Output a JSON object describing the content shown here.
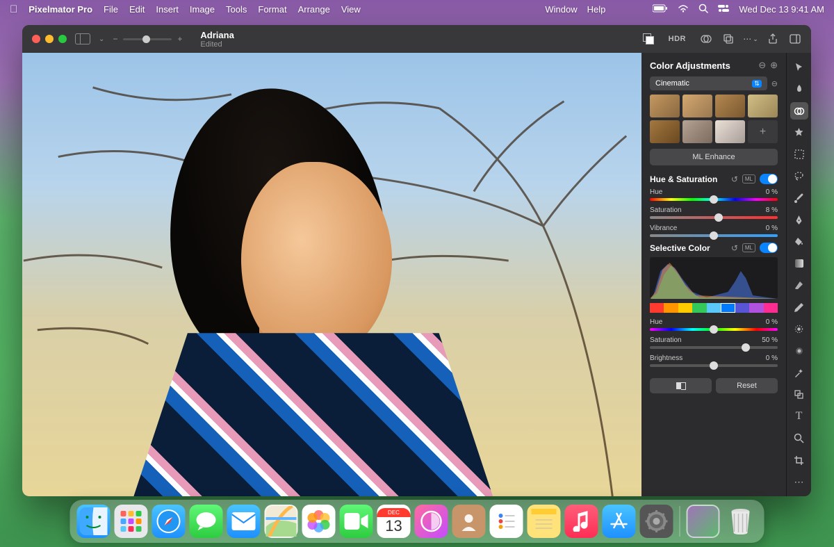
{
  "menubar": {
    "app": "Pixelmator Pro",
    "items": [
      "File",
      "Edit",
      "Insert",
      "Image",
      "Tools",
      "Format",
      "Arrange",
      "View"
    ],
    "right_items": [
      "Window",
      "Help"
    ],
    "datetime": "Wed Dec 13  9:41 AM"
  },
  "window": {
    "doc_name": "Adriana",
    "doc_status": "Edited",
    "hdr_label": "HDR"
  },
  "panel": {
    "title": "Color Adjustments",
    "preset": "Cinematic",
    "ml_enhance": "ML Enhance",
    "ml_badge": "ML",
    "sections": {
      "hue_sat": {
        "title": "Hue & Saturation",
        "sliders": [
          {
            "label": "Hue",
            "value": "0 %",
            "pos": 50,
            "track": "hue"
          },
          {
            "label": "Saturation",
            "value": "8 %",
            "pos": 54,
            "track": "sat"
          },
          {
            "label": "Vibrance",
            "value": "0 %",
            "pos": 50,
            "track": "vib"
          }
        ]
      },
      "selective": {
        "title": "Selective Color",
        "swatches": [
          "#ff3b30",
          "#ff9500",
          "#ffcc00",
          "#34c759",
          "#5ac8fa",
          "#007aff",
          "#5856d6",
          "#af52de",
          "#ff2d92"
        ],
        "selected_swatch": 5,
        "sliders": [
          {
            "label": "Hue",
            "value": "0 %",
            "pos": 50,
            "track": "hue2"
          },
          {
            "label": "Saturation",
            "value": "50 %",
            "pos": 75,
            "track": "plain"
          },
          {
            "label": "Brightness",
            "value": "0 %",
            "pos": 50,
            "track": "plain"
          }
        ]
      }
    },
    "reset": "Reset"
  },
  "calendar": {
    "month": "DEC",
    "day": "13"
  },
  "tools": [
    "arrow",
    "hand",
    "adjust",
    "star",
    "marquee",
    "lasso",
    "brush",
    "pen",
    "bucket",
    "gradient",
    "erase",
    "pencil",
    "smudge",
    "blur",
    "wand",
    "clone",
    "type",
    "zoom",
    "crop"
  ]
}
